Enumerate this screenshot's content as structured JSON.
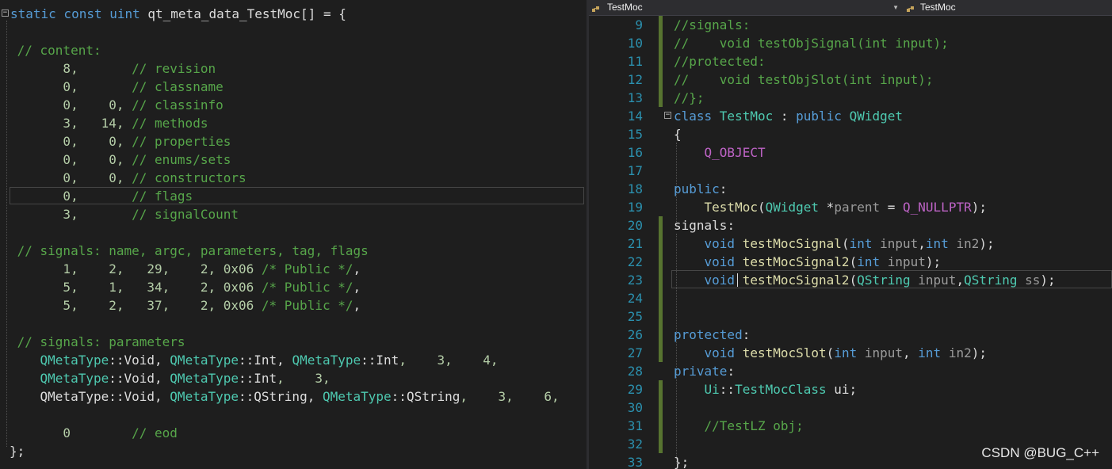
{
  "left_editor": {
    "lines": [
      [
        {
          "t": "static const uint ",
          "c": "kw"
        },
        {
          "t": "qt_meta_data_TestMoc[] = {",
          "c": "tx"
        }
      ],
      [],
      [
        {
          "t": " // content:",
          "c": "cm"
        }
      ],
      [
        {
          "t": "       8,       ",
          "c": "nm"
        },
        {
          "t": "// revision",
          "c": "cm"
        }
      ],
      [
        {
          "t": "       0,       ",
          "c": "nm"
        },
        {
          "t": "// classname",
          "c": "cm"
        }
      ],
      [
        {
          "t": "       0,    0, ",
          "c": "nm"
        },
        {
          "t": "// classinfo",
          "c": "cm"
        }
      ],
      [
        {
          "t": "       3,   14, ",
          "c": "nm"
        },
        {
          "t": "// methods",
          "c": "cm"
        }
      ],
      [
        {
          "t": "       0,    0, ",
          "c": "nm"
        },
        {
          "t": "// properties",
          "c": "cm"
        }
      ],
      [
        {
          "t": "       0,    0, ",
          "c": "nm"
        },
        {
          "t": "// enums/sets",
          "c": "cm"
        }
      ],
      [
        {
          "t": "       0,    0, ",
          "c": "nm"
        },
        {
          "t": "// constructors",
          "c": "cm"
        }
      ],
      [
        {
          "t": "       0,       ",
          "c": "nm"
        },
        {
          "t": "// flags",
          "c": "cm"
        }
      ],
      [
        {
          "t": "       3,       ",
          "c": "nm"
        },
        {
          "t": "// signalCount",
          "c": "cm"
        }
      ],
      [],
      [
        {
          "t": " // signals: name, argc, parameters, tag, flags",
          "c": "cm"
        }
      ],
      [
        {
          "t": "       1,    2,   29,    2, 0x06 ",
          "c": "nm"
        },
        {
          "t": "/* Public */",
          "c": "cm"
        },
        {
          "t": ",",
          "c": "tx"
        }
      ],
      [
        {
          "t": "       5,    1,   34,    2, 0x06 ",
          "c": "nm"
        },
        {
          "t": "/* Public */",
          "c": "cm"
        },
        {
          "t": ",",
          "c": "tx"
        }
      ],
      [
        {
          "t": "       5,    2,   37,    2, 0x06 ",
          "c": "nm"
        },
        {
          "t": "/* Public */",
          "c": "cm"
        },
        {
          "t": ",",
          "c": "tx"
        }
      ],
      [],
      [
        {
          "t": " // signals: parameters",
          "c": "cm"
        }
      ],
      [
        {
          "t": "    ",
          "c": "tx"
        },
        {
          "t": "QMetaType",
          "c": "ty"
        },
        {
          "t": "::",
          "c": "tx"
        },
        {
          "t": "Void",
          "c": "tx"
        },
        {
          "t": ", ",
          "c": "tx"
        },
        {
          "t": "QMetaType",
          "c": "ty"
        },
        {
          "t": "::",
          "c": "tx"
        },
        {
          "t": "Int",
          "c": "tx"
        },
        {
          "t": ", ",
          "c": "tx"
        },
        {
          "t": "QMetaType",
          "c": "ty"
        },
        {
          "t": "::",
          "c": "tx"
        },
        {
          "t": "Int",
          "c": "tx"
        },
        {
          "t": ",    3,    4,",
          "c": "nm"
        }
      ],
      [
        {
          "t": "    ",
          "c": "tx"
        },
        {
          "t": "QMetaType",
          "c": "ty"
        },
        {
          "t": "::",
          "c": "tx"
        },
        {
          "t": "Void",
          "c": "tx"
        },
        {
          "t": ", ",
          "c": "tx"
        },
        {
          "t": "QMetaType",
          "c": "ty"
        },
        {
          "t": "::",
          "c": "tx"
        },
        {
          "t": "Int",
          "c": "tx"
        },
        {
          "t": ",    3,",
          "c": "nm"
        }
      ],
      [
        {
          "t": "    QMetaType::Void, ",
          "c": "tx"
        },
        {
          "t": "QMetaType",
          "c": "ty"
        },
        {
          "t": "::",
          "c": "tx"
        },
        {
          "t": "QString",
          "c": "tx"
        },
        {
          "t": ", ",
          "c": "tx"
        },
        {
          "t": "QMetaType",
          "c": "ty"
        },
        {
          "t": "::",
          "c": "tx"
        },
        {
          "t": "QString",
          "c": "tx"
        },
        {
          "t": ",    3,    6,",
          "c": "nm"
        }
      ],
      [],
      [
        {
          "t": "       0        ",
          "c": "nm"
        },
        {
          "t": "// eod",
          "c": "cm"
        }
      ],
      [
        {
          "t": "};",
          "c": "tx"
        }
      ]
    ]
  },
  "right_editor": {
    "nav_left": "TestMoc",
    "nav_right": "TestMoc",
    "watermark": "CSDN @BUG_C++",
    "lines": [
      {
        "n": "9",
        "chg": true,
        "segs": [
          {
            "t": "//signals:",
            "c": "cm"
          }
        ]
      },
      {
        "n": "10",
        "chg": true,
        "segs": [
          {
            "t": "//    void testObjSignal(int input);",
            "c": "cm"
          }
        ]
      },
      {
        "n": "11",
        "chg": true,
        "segs": [
          {
            "t": "//protected:",
            "c": "cm"
          }
        ]
      },
      {
        "n": "12",
        "chg": true,
        "segs": [
          {
            "t": "//    void testObjSlot(int input);",
            "c": "cm"
          }
        ]
      },
      {
        "n": "13",
        "chg": true,
        "segs": [
          {
            "t": "//};",
            "c": "cm"
          }
        ]
      },
      {
        "n": "14",
        "chg": false,
        "segs": [
          {
            "t": "class ",
            "c": "kw"
          },
          {
            "t": "TestMoc",
            "c": "cl"
          },
          {
            "t": " : ",
            "c": "tx"
          },
          {
            "t": "public ",
            "c": "kw"
          },
          {
            "t": "QWidget",
            "c": "cl"
          }
        ]
      },
      {
        "n": "15",
        "chg": false,
        "segs": [
          {
            "t": "{",
            "c": "tx"
          }
        ]
      },
      {
        "n": "16",
        "chg": false,
        "segs": [
          {
            "t": "    ",
            "c": "tx"
          },
          {
            "t": "Q_OBJECT",
            "c": "mc"
          }
        ]
      },
      {
        "n": "17",
        "chg": false,
        "segs": []
      },
      {
        "n": "18",
        "chg": false,
        "segs": [
          {
            "t": "public",
            "c": "kw"
          },
          {
            "t": ":",
            "c": "tx"
          }
        ]
      },
      {
        "n": "19",
        "chg": false,
        "segs": [
          {
            "t": "    ",
            "c": "tx"
          },
          {
            "t": "TestMoc",
            "c": "fn"
          },
          {
            "t": "(",
            "c": "tx"
          },
          {
            "t": "QWidget",
            "c": "cl"
          },
          {
            "t": " *",
            "c": "tx"
          },
          {
            "t": "parent",
            "c": "pm"
          },
          {
            "t": " = ",
            "c": "tx"
          },
          {
            "t": "Q_NULLPTR",
            "c": "mc"
          },
          {
            "t": ");",
            "c": "tx"
          }
        ]
      },
      {
        "n": "20",
        "chg": true,
        "segs": [
          {
            "t": "signals",
            "c": "tx"
          },
          {
            "t": ":",
            "c": "tx"
          }
        ]
      },
      {
        "n": "21",
        "chg": true,
        "segs": [
          {
            "t": "    ",
            "c": "tx"
          },
          {
            "t": "void ",
            "c": "kw"
          },
          {
            "t": "testMocSignal",
            "c": "fn"
          },
          {
            "t": "(",
            "c": "tx"
          },
          {
            "t": "int ",
            "c": "kw"
          },
          {
            "t": "input",
            "c": "pm"
          },
          {
            "t": ",",
            "c": "tx"
          },
          {
            "t": "int ",
            "c": "kw"
          },
          {
            "t": "in2",
            "c": "pm"
          },
          {
            "t": ");",
            "c": "tx"
          }
        ]
      },
      {
        "n": "22",
        "chg": true,
        "segs": [
          {
            "t": "    ",
            "c": "tx"
          },
          {
            "t": "void ",
            "c": "kw"
          },
          {
            "t": "testMocSignal2",
            "c": "fn"
          },
          {
            "t": "(",
            "c": "tx"
          },
          {
            "t": "int ",
            "c": "kw"
          },
          {
            "t": "input",
            "c": "pm"
          },
          {
            "t": ");",
            "c": "tx"
          }
        ]
      },
      {
        "n": "23",
        "chg": true,
        "segs": [
          {
            "t": "    ",
            "c": "tx"
          },
          {
            "t": "void ",
            "c": "kw"
          },
          {
            "t": "testMocSignal2",
            "c": "fn"
          },
          {
            "t": "(",
            "c": "tx"
          },
          {
            "t": "QString ",
            "c": "cl"
          },
          {
            "t": "input",
            "c": "pm"
          },
          {
            "t": ",",
            "c": "tx"
          },
          {
            "t": "QString ",
            "c": "cl"
          },
          {
            "t": "ss",
            "c": "pm"
          },
          {
            "t": ");",
            "c": "tx"
          }
        ]
      },
      {
        "n": "24",
        "chg": true,
        "segs": []
      },
      {
        "n": "25",
        "chg": true,
        "segs": []
      },
      {
        "n": "26",
        "chg": true,
        "segs": [
          {
            "t": "protected",
            "c": "kw"
          },
          {
            "t": ":",
            "c": "tx"
          }
        ]
      },
      {
        "n": "27",
        "chg": true,
        "segs": [
          {
            "t": "    ",
            "c": "tx"
          },
          {
            "t": "void ",
            "c": "kw"
          },
          {
            "t": "testMocSlot",
            "c": "fn"
          },
          {
            "t": "(",
            "c": "tx"
          },
          {
            "t": "int ",
            "c": "kw"
          },
          {
            "t": "input",
            "c": "pm"
          },
          {
            "t": ", ",
            "c": "tx"
          },
          {
            "t": "int ",
            "c": "kw"
          },
          {
            "t": "in2",
            "c": "pm"
          },
          {
            "t": ");",
            "c": "tx"
          }
        ]
      },
      {
        "n": "28",
        "chg": false,
        "segs": [
          {
            "t": "private",
            "c": "kw"
          },
          {
            "t": ":",
            "c": "tx"
          }
        ]
      },
      {
        "n": "29",
        "chg": true,
        "segs": [
          {
            "t": "    ",
            "c": "tx"
          },
          {
            "t": "Ui",
            "c": "cl"
          },
          {
            "t": "::",
            "c": "tx"
          },
          {
            "t": "TestMocClass",
            "c": "cl"
          },
          {
            "t": " ui;",
            "c": "tx"
          }
        ]
      },
      {
        "n": "30",
        "chg": true,
        "segs": []
      },
      {
        "n": "31",
        "chg": true,
        "segs": [
          {
            "t": "    ",
            "c": "tx"
          },
          {
            "t": "//TestLZ obj;",
            "c": "cm"
          }
        ]
      },
      {
        "n": "32",
        "chg": true,
        "segs": []
      },
      {
        "n": "33",
        "chg": false,
        "segs": [
          {
            "t": "};",
            "c": "tx"
          }
        ]
      }
    ]
  }
}
